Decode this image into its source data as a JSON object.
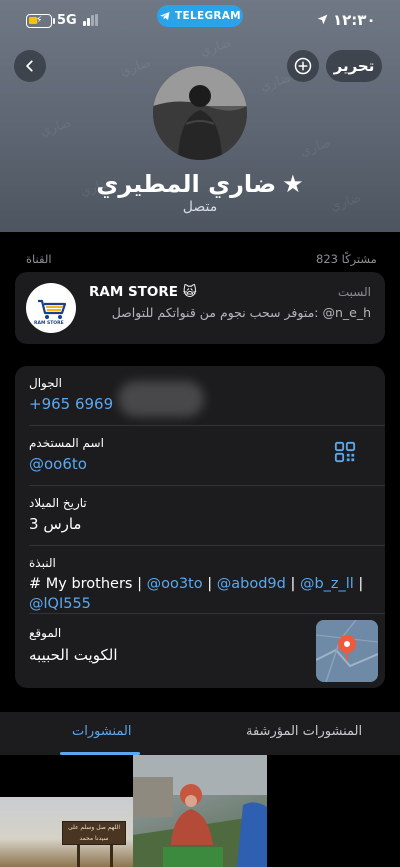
{
  "status_bar": {
    "network": "5G",
    "time": "١٢:٣٠",
    "app_pill": "TELEGRAM"
  },
  "header": {
    "edit_label": "تحرير",
    "name": "ضاري المطيري",
    "presence": "متصل",
    "pattern_text": "ضاري"
  },
  "channel": {
    "section_label": "القناة",
    "subscribers": "823 مشتركًا",
    "name": "RAM STORE 🙀",
    "time": "السبت",
    "last_message": "متوفر سحب نجوم من قنواتكم للتواصل: @n_e_h",
    "logo_text": "RAM STORE"
  },
  "info": {
    "phone_label": "الجوال",
    "phone_value": "+965 6969",
    "username_label": "اسم المستخدم",
    "username_value": "@oo6to",
    "birthday_label": "تاريخ الميلاد",
    "birthday_value": "3 مارس",
    "bio_label": "النبذة",
    "bio_prefix": "# My brothers | ",
    "bio_link1": "@oo3to",
    "bio_sep": " | ",
    "bio_link2": "@abod9d",
    "bio_link3": "@b_z_ll",
    "bio_link4": "@lQI555",
    "location_label": "الموقع",
    "location_value": "الكويت الحبيبه"
  },
  "tabs": {
    "posts": "المنشورات",
    "archived": "المنشورات المؤرشفة"
  },
  "posts": {
    "sign_line1": "اللهم صل وسلم على",
    "sign_line2": "سيدنا محمد"
  },
  "colors": {
    "accent": "#5aa8f0",
    "telegram": "#2aa4e8",
    "card": "#1c1c1e",
    "map_pin": "#ef5a3c"
  }
}
